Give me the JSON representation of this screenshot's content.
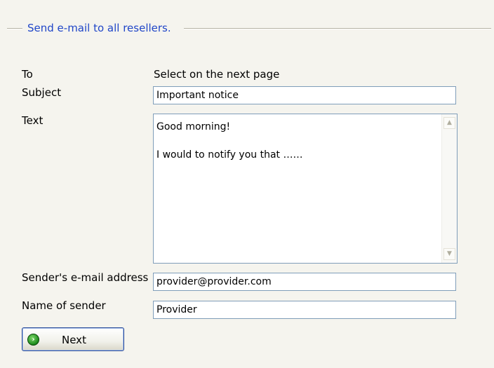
{
  "fieldset": {
    "legend": "Send e-mail to all resellers."
  },
  "form": {
    "to_label": "To",
    "to_value": "Select on the next page",
    "subject_label": "Subject",
    "subject_value": "Important notice",
    "text_label": "Text",
    "text_lines": [
      "Good morning!",
      "",
      "I would to notify you that ……"
    ],
    "sender_email_label": "Sender's e-mail address",
    "sender_email_value": "provider@provider.com",
    "sender_name_label": "Name of sender",
    "sender_name_value": "Provider"
  },
  "next_button": {
    "label": "Next",
    "icon": "arrow-right-circle-icon",
    "icon_color": "#1b8a1b"
  },
  "colors": {
    "legend": "#2046c8",
    "field_border": "#7f9db9",
    "background": "#f5f4ee"
  }
}
